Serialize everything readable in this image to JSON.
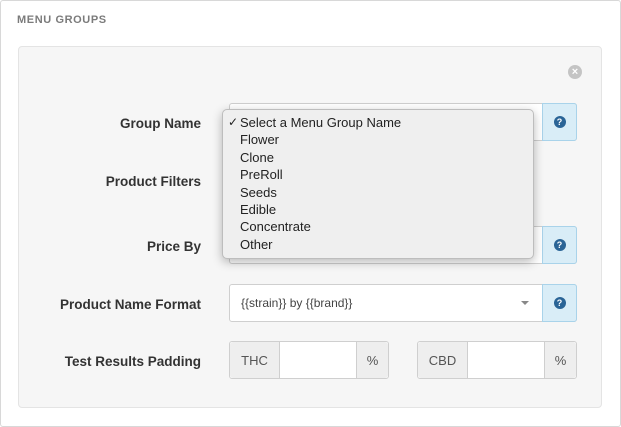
{
  "section_title": "MENU GROUPS",
  "form": {
    "group_name_label": "Group Name",
    "product_filters_label": "Product Filters",
    "price_by_label": "Price By",
    "product_name_format_label": "Product Name Format",
    "product_name_format_value": "{{strain}} by {{brand}}",
    "test_results_padding_label": "Test Results Padding",
    "thc_label": "THC",
    "thc_value": "",
    "thc_unit": "%",
    "cbd_label": "CBD",
    "cbd_value": "",
    "cbd_unit": "%"
  },
  "group_name_dropdown": {
    "selected": "Select a Menu Group Name",
    "options": [
      "Select a Menu Group Name",
      "Flower",
      "Clone",
      "PreRoll",
      "Seeds",
      "Edible",
      "Concentrate",
      "Other"
    ]
  },
  "icons": {
    "close": "close-circle-icon",
    "help": "question-circle-icon",
    "checkmark": "checkmark-icon",
    "caret": "caret-down-icon"
  },
  "colors": {
    "help_button_bg": "#d9edf7",
    "help_icon": "#2a6496",
    "card_bg": "#f6f6f6"
  }
}
